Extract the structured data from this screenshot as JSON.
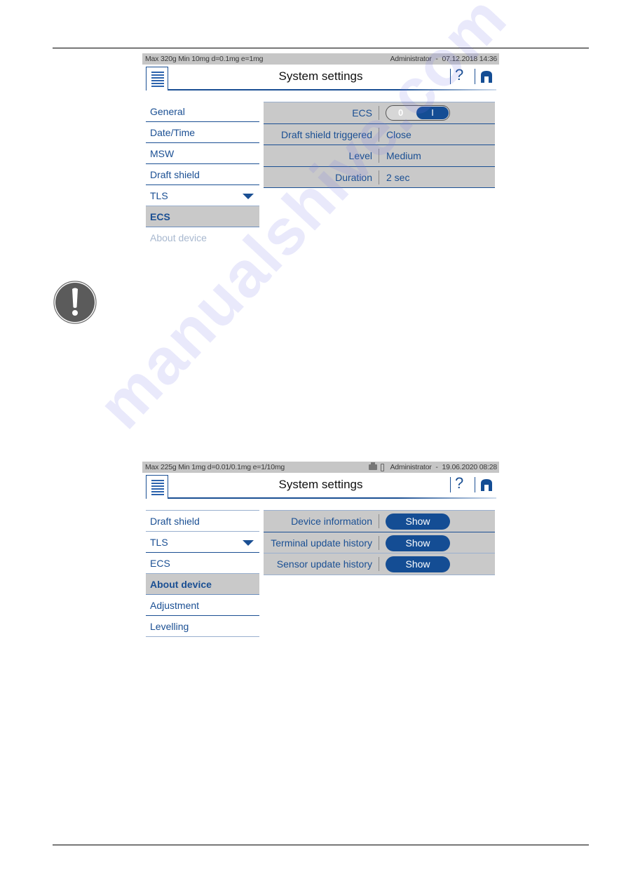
{
  "page": {
    "watermark": "manualshive.com"
  },
  "screens": [
    {
      "statusbar": {
        "specs": "Max 320g  Min 10mg  d=0.1mg  e=1mg",
        "user": "Administrator",
        "datetime_sep": " - ",
        "datetime": "07.12.2018 14:36",
        "icons": []
      },
      "title": "System settings",
      "help_label": "?",
      "sidebar": [
        {
          "label": "General",
          "state": "normal"
        },
        {
          "label": "Date/Time",
          "state": "normal"
        },
        {
          "label": "MSW",
          "state": "normal"
        },
        {
          "label": "Draft shield",
          "state": "normal"
        },
        {
          "label": "TLS",
          "state": "expandable"
        },
        {
          "label": "ECS",
          "state": "active"
        },
        {
          "label": "About device",
          "state": "faded"
        }
      ],
      "settings": [
        {
          "label": "ECS",
          "type": "toggle",
          "off_label": "0",
          "on_label": "I",
          "value": "on"
        },
        {
          "label": "Draft shield triggered",
          "type": "value",
          "value": "Close"
        },
        {
          "label": "Level",
          "type": "value",
          "value": "Medium"
        },
        {
          "label": "Duration",
          "type": "value",
          "value": "2 sec"
        }
      ]
    },
    {
      "statusbar": {
        "specs": "Max 225g  Min 1mg  d=0.01/0.1mg  e=1/10mg",
        "user": "Administrator",
        "datetime_sep": " - ",
        "datetime": "19.06.2020 08:28",
        "icons": [
          "printer-icon",
          "usb-icon"
        ]
      },
      "title": "System settings",
      "help_label": "?",
      "sidebar": [
        {
          "label": "Draft shield",
          "state": "normal"
        },
        {
          "label": "TLS",
          "state": "expandable"
        },
        {
          "label": "ECS",
          "state": "normal"
        },
        {
          "label": "About device",
          "state": "active"
        },
        {
          "label": "Adjustment",
          "state": "normal"
        },
        {
          "label": "Levelling",
          "state": "normal"
        }
      ],
      "settings": [
        {
          "label": "Device information",
          "type": "button",
          "button_label": "Show"
        },
        {
          "label": "Terminal update history",
          "type": "button",
          "button_label": "Show"
        },
        {
          "label": "Sensor update history",
          "type": "button",
          "button_label": "Show"
        }
      ]
    }
  ],
  "note": {
    "icon": "exclamation-circle-icon"
  }
}
